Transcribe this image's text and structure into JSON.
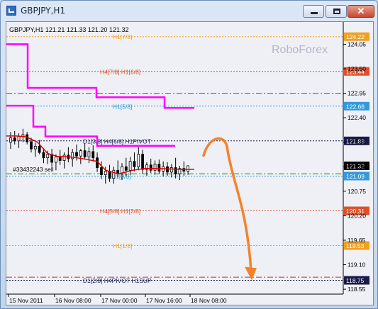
{
  "window": {
    "title": "GBPJPY,H1",
    "buttons": {
      "minimize": "minimize-icon",
      "maximize": "maximize-icon",
      "close": "close-icon"
    }
  },
  "chart": {
    "info": "GBPJPY,H1  121.21 121.33 121.20 121.32",
    "watermark": "RoboForex",
    "order_label": "#33432243 sell",
    "current_price": "121.32",
    "colors": {
      "background": "#eef0f6",
      "candles": "#000000",
      "ma": "#e00000",
      "murrey": "#ff00ff",
      "arrow": "#f5822a",
      "orange_level": "#f0a020",
      "red_level": "#e0502a",
      "blue_level": "#3399dd",
      "dark_level": "#1a1a4a"
    },
    "price_scale": [
      "124.05",
      "123.50",
      "122.95",
      "122.40",
      "121.85",
      "121.30",
      "120.75",
      "120.20",
      "119.65",
      "119.10",
      "118.55"
    ],
    "time_axis": [
      "15 Nov 2011",
      "16 Nov 08:00",
      "17 Nov 00:00",
      "17 Nov 16:00",
      "18 Nov 08:00"
    ]
  },
  "chart_data": {
    "type": "candlestick",
    "symbol": "GBPJPY",
    "timeframe": "H1",
    "ohlc_last": {
      "open": 121.21,
      "high": 121.33,
      "low": 121.2,
      "close": 121.32
    },
    "ylim": [
      118.44,
      124.55
    ],
    "levels": [
      {
        "name": "H1[7/8]",
        "price": 124.22,
        "badge": "124.22",
        "color": "#f0a020",
        "style": "dotted"
      },
      {
        "name": "H4[7/8] H1[6/8]",
        "price": 123.44,
        "badge": "123.44",
        "color": "#e0502a",
        "style": "dotted"
      },
      {
        "name": "",
        "price": 122.95,
        "badge": "",
        "color": "#c0302a",
        "style": "dashdot"
      },
      {
        "name": "H1[5/8]",
        "price": 122.66,
        "badge": "122.66",
        "color": "#3399dd",
        "style": "dotted"
      },
      {
        "name": "D1[3/8] H4[6/8] H1PIVOT",
        "price": 121.88,
        "badge": "121.88",
        "color": "#1a1a4a",
        "style": "dotted"
      },
      {
        "name": "",
        "price": 121.32,
        "badge": "121.32",
        "color": "#000000",
        "style": "none"
      },
      {
        "name": "H1[3/8]",
        "price": 121.09,
        "badge": "121.09",
        "color": "#3399dd",
        "style": "dotted"
      },
      {
        "name": "",
        "price": 121.14,
        "badge": "",
        "color": "#1a8a1a",
        "style": "dashdot"
      },
      {
        "name": "H4[5/8] H1[2/8]",
        "price": 120.31,
        "badge": "120.31",
        "color": "#e0502a",
        "style": "dotted"
      },
      {
        "name": "H1[1/8]",
        "price": 119.53,
        "badge": "119.53",
        "color": "#f0a020",
        "style": "dotted"
      },
      {
        "name": "D1[2/8] H4PIVOT H1SUP",
        "price": 118.75,
        "badge": "118.75",
        "color": "#1a1a4a",
        "style": "dotted"
      },
      {
        "name": "",
        "price": 118.82,
        "badge": "",
        "color": "#c0302a",
        "style": "dashdot"
      }
    ],
    "murrey_upper": [
      {
        "x0": 0,
        "x1": 30,
        "y": 124.05
      },
      {
        "x0": 30,
        "x1": 127,
        "y": 123.07
      },
      {
        "x0": 127,
        "x1": 223,
        "y": 122.86
      },
      {
        "x0": 223,
        "x1": 265,
        "y": 122.62
      }
    ],
    "murrey_lower": [
      {
        "x0": 0,
        "x1": 38,
        "y": 122.67
      },
      {
        "x0": 38,
        "x1": 55,
        "y": 122.2
      },
      {
        "x0": 55,
        "x1": 128,
        "y": 121.98
      },
      {
        "x0": 128,
        "x1": 238,
        "y": 121.77
      }
    ],
    "ma_line": [
      [
        0,
        121.99
      ],
      [
        14,
        121.99
      ],
      [
        28,
        121.97
      ],
      [
        44,
        121.85
      ],
      [
        58,
        121.6
      ],
      [
        72,
        121.53
      ],
      [
        90,
        121.52
      ],
      [
        108,
        121.48
      ],
      [
        128,
        121.42
      ],
      [
        140,
        121.22
      ],
      [
        158,
        121.14
      ],
      [
        178,
        121.22
      ],
      [
        195,
        121.26
      ],
      [
        212,
        121.26
      ],
      [
        230,
        121.25
      ],
      [
        250,
        121.24
      ],
      [
        265,
        121.24
      ]
    ],
    "candles": [
      [
        121.85,
        122.08,
        121.7,
        121.95
      ],
      [
        121.95,
        122.1,
        121.8,
        121.88
      ],
      [
        121.88,
        122.05,
        121.72,
        121.98
      ],
      [
        121.98,
        122.15,
        121.85,
        122.02
      ],
      [
        122.02,
        122.08,
        121.8,
        121.86
      ],
      [
        121.86,
        121.95,
        121.62,
        121.7
      ],
      [
        121.7,
        121.84,
        121.52,
        121.76
      ],
      [
        121.76,
        121.9,
        121.58,
        121.62
      ],
      [
        121.62,
        121.72,
        121.38,
        121.5
      ],
      [
        121.5,
        121.66,
        121.36,
        121.58
      ],
      [
        121.58,
        121.7,
        121.3,
        121.4
      ],
      [
        121.4,
        121.58,
        121.22,
        121.52
      ],
      [
        121.52,
        121.68,
        121.34,
        121.44
      ],
      [
        121.44,
        121.62,
        121.26,
        121.56
      ],
      [
        121.56,
        121.74,
        121.4,
        121.48
      ],
      [
        121.48,
        121.7,
        121.3,
        121.62
      ],
      [
        121.62,
        121.8,
        121.44,
        121.54
      ],
      [
        121.54,
        121.7,
        121.36,
        121.66
      ],
      [
        121.66,
        121.82,
        121.46,
        121.52
      ],
      [
        121.52,
        121.74,
        121.38,
        121.64
      ],
      [
        121.64,
        121.78,
        121.42,
        121.5
      ],
      [
        121.5,
        121.62,
        121.18,
        121.28
      ],
      [
        121.28,
        121.42,
        121.02,
        121.12
      ],
      [
        121.12,
        121.3,
        120.92,
        121.2
      ],
      [
        121.2,
        121.34,
        120.96,
        121.04
      ],
      [
        121.04,
        121.3,
        120.92,
        121.22
      ],
      [
        121.22,
        121.44,
        121.06,
        121.16
      ],
      [
        121.16,
        121.38,
        121.0,
        121.3
      ],
      [
        121.3,
        121.5,
        121.1,
        121.22
      ],
      [
        121.22,
        121.52,
        121.12,
        121.42
      ],
      [
        121.42,
        121.62,
        121.2,
        121.3
      ],
      [
        121.3,
        121.74,
        121.22,
        121.58
      ],
      [
        121.58,
        121.68,
        121.14,
        121.24
      ],
      [
        121.24,
        121.4,
        121.1,
        121.34
      ],
      [
        121.34,
        121.48,
        121.16,
        121.22
      ],
      [
        121.22,
        121.44,
        121.12,
        121.36
      ],
      [
        121.36,
        121.46,
        121.14,
        121.2
      ],
      [
        121.2,
        121.42,
        121.08,
        121.3
      ],
      [
        121.3,
        121.4,
        121.1,
        121.18
      ],
      [
        121.18,
        121.36,
        121.06,
        121.28
      ],
      [
        121.28,
        121.5,
        121.04,
        121.14
      ],
      [
        121.14,
        121.32,
        121.0,
        121.26
      ],
      [
        121.26,
        121.42,
        121.1,
        121.2
      ],
      [
        121.2,
        121.33,
        121.12,
        121.32
      ]
    ],
    "forecast_arrow": {
      "start": [
        278,
        121.55
      ],
      "peak": [
        298,
        121.85
      ],
      "end": [
        345,
        118.8
      ],
      "color": "#f5822a"
    }
  }
}
